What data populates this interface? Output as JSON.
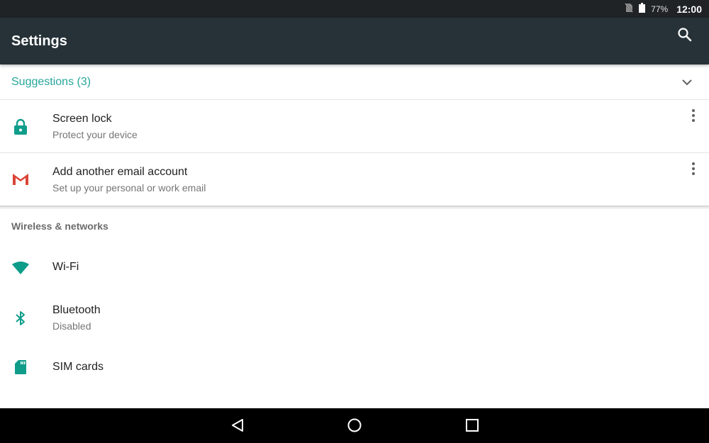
{
  "status_bar": {
    "battery_percent": "77%",
    "time": "12:00",
    "icons": [
      "no-sim-icon",
      "battery-icon"
    ]
  },
  "app_bar": {
    "title": "Settings",
    "search_icon": "search-icon"
  },
  "suggestions": {
    "header": "Suggestions (3)",
    "items": [
      {
        "title": "Screen lock",
        "subtitle": "Protect your device",
        "icon": "lock-icon"
      },
      {
        "title": "Add another email account",
        "subtitle": "Set up your personal or work email",
        "icon": "gmail-icon"
      }
    ]
  },
  "wireless": {
    "header": "Wireless & networks",
    "items": [
      {
        "title": "Wi-Fi",
        "icon": "wifi-icon"
      },
      {
        "title": "Bluetooth",
        "subtitle": "Disabled",
        "icon": "bluetooth-icon"
      },
      {
        "title": "SIM cards",
        "icon": "sim-card-icon"
      }
    ]
  },
  "colors": {
    "app_bar": "#263238",
    "accent": "#26a69a",
    "status_bar": "#1f2326"
  },
  "nav_bar": {
    "icons": [
      "back-icon",
      "home-icon",
      "recents-icon"
    ]
  }
}
